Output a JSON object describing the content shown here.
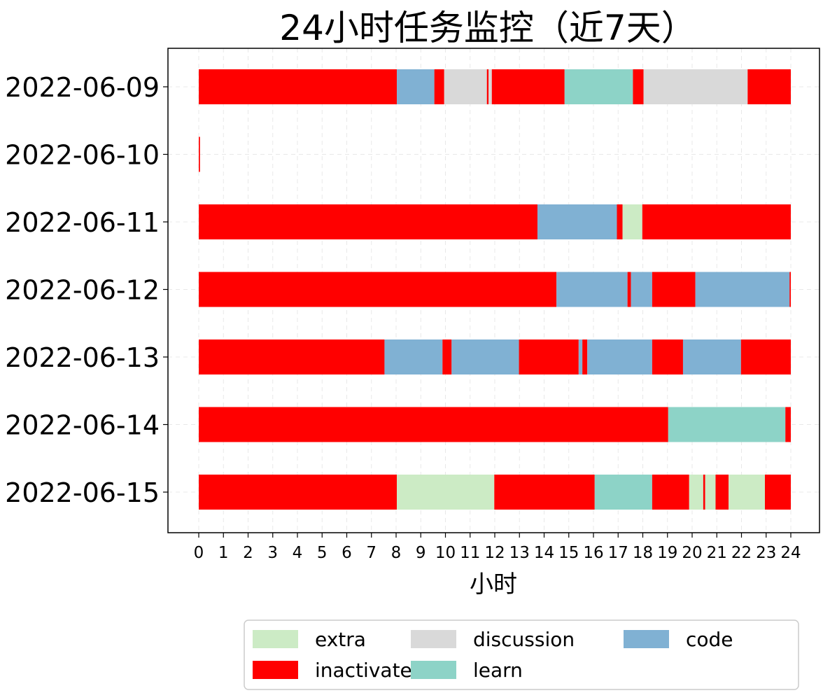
{
  "chart_data": {
    "type": "bar",
    "orientation": "horizontal-stacked-timeline",
    "title": "24小时任务监控（近7天）",
    "xlabel": "小时",
    "ylabel": "",
    "xlim": [
      0,
      24
    ],
    "xticks": [
      "0",
      "1",
      "2",
      "3",
      "4",
      "5",
      "6",
      "7",
      "8",
      "9",
      "10",
      "11",
      "12",
      "13",
      "14",
      "15",
      "16",
      "17",
      "18",
      "19",
      "20",
      "21",
      "22",
      "23",
      "24"
    ],
    "grid": true,
    "legend_position": "bottom",
    "legend": [
      {
        "name": "extra",
        "color": "#ccebc5"
      },
      {
        "name": "inactivate",
        "color": "#ff0000"
      },
      {
        "name": "discussion",
        "color": "#d9d9d9"
      },
      {
        "name": "learn",
        "color": "#8dd3c7"
      },
      {
        "name": "code",
        "color": "#80b1d3"
      }
    ],
    "categories": [
      "2022-06-09",
      "2022-06-10",
      "2022-06-11",
      "2022-06-12",
      "2022-06-13",
      "2022-06-14",
      "2022-06-15"
    ],
    "rows": [
      {
        "date": "2022-06-09",
        "segments": [
          {
            "start": 0,
            "end": 8.03,
            "type": "inactivate"
          },
          {
            "start": 8.03,
            "end": 9.55,
            "type": "code"
          },
          {
            "start": 9.55,
            "end": 9.95,
            "type": "inactivate"
          },
          {
            "start": 9.95,
            "end": 11.68,
            "type": "discussion"
          },
          {
            "start": 11.68,
            "end": 11.75,
            "type": "inactivate"
          },
          {
            "start": 11.75,
            "end": 11.88,
            "type": "discussion"
          },
          {
            "start": 11.88,
            "end": 14.83,
            "type": "inactivate"
          },
          {
            "start": 14.83,
            "end": 17.6,
            "type": "learn"
          },
          {
            "start": 17.6,
            "end": 18.03,
            "type": "inactivate"
          },
          {
            "start": 18.03,
            "end": 22.25,
            "type": "discussion"
          },
          {
            "start": 22.25,
            "end": 24,
            "type": "inactivate"
          }
        ]
      },
      {
        "date": "2022-06-10",
        "segments": [
          {
            "start": 0,
            "end": 0.05,
            "type": "inactivate"
          }
        ]
      },
      {
        "date": "2022-06-11",
        "segments": [
          {
            "start": 0,
            "end": 13.73,
            "type": "inactivate"
          },
          {
            "start": 13.73,
            "end": 16.95,
            "type": "code"
          },
          {
            "start": 16.95,
            "end": 17.18,
            "type": "inactivate"
          },
          {
            "start": 17.18,
            "end": 17.98,
            "type": "extra"
          },
          {
            "start": 17.98,
            "end": 24,
            "type": "inactivate"
          }
        ]
      },
      {
        "date": "2022-06-12",
        "segments": [
          {
            "start": 0,
            "end": 14.5,
            "type": "inactivate"
          },
          {
            "start": 14.5,
            "end": 17.38,
            "type": "code"
          },
          {
            "start": 17.38,
            "end": 17.52,
            "type": "inactivate"
          },
          {
            "start": 17.52,
            "end": 18.38,
            "type": "code"
          },
          {
            "start": 18.38,
            "end": 20.13,
            "type": "inactivate"
          },
          {
            "start": 20.13,
            "end": 23.95,
            "type": "code"
          },
          {
            "start": 23.95,
            "end": 24,
            "type": "inactivate"
          }
        ]
      },
      {
        "date": "2022-06-13",
        "segments": [
          {
            "start": 0,
            "end": 7.53,
            "type": "inactivate"
          },
          {
            "start": 7.53,
            "end": 9.88,
            "type": "code"
          },
          {
            "start": 9.88,
            "end": 10.25,
            "type": "inactivate"
          },
          {
            "start": 10.25,
            "end": 12.98,
            "type": "code"
          },
          {
            "start": 12.98,
            "end": 15.4,
            "type": "inactivate"
          },
          {
            "start": 15.4,
            "end": 15.55,
            "type": "code"
          },
          {
            "start": 15.55,
            "end": 15.75,
            "type": "inactivate"
          },
          {
            "start": 15.75,
            "end": 18.38,
            "type": "code"
          },
          {
            "start": 18.38,
            "end": 19.63,
            "type": "inactivate"
          },
          {
            "start": 19.63,
            "end": 21.98,
            "type": "code"
          },
          {
            "start": 21.98,
            "end": 24,
            "type": "inactivate"
          }
        ]
      },
      {
        "date": "2022-06-14",
        "segments": [
          {
            "start": 0,
            "end": 19.03,
            "type": "inactivate"
          },
          {
            "start": 19.03,
            "end": 23.78,
            "type": "learn"
          },
          {
            "start": 23.78,
            "end": 24,
            "type": "inactivate"
          }
        ]
      },
      {
        "date": "2022-06-15",
        "segments": [
          {
            "start": 0,
            "end": 8.03,
            "type": "inactivate"
          },
          {
            "start": 8.03,
            "end": 11.98,
            "type": "extra"
          },
          {
            "start": 11.98,
            "end": 16.05,
            "type": "inactivate"
          },
          {
            "start": 16.05,
            "end": 18.38,
            "type": "learn"
          },
          {
            "start": 18.38,
            "end": 19.88,
            "type": "inactivate"
          },
          {
            "start": 19.88,
            "end": 20.45,
            "type": "extra"
          },
          {
            "start": 20.45,
            "end": 20.53,
            "type": "inactivate"
          },
          {
            "start": 20.53,
            "end": 20.95,
            "type": "extra"
          },
          {
            "start": 20.95,
            "end": 21.48,
            "type": "inactivate"
          },
          {
            "start": 21.48,
            "end": 22.95,
            "type": "extra"
          },
          {
            "start": 22.95,
            "end": 24,
            "type": "inactivate"
          }
        ]
      }
    ]
  }
}
